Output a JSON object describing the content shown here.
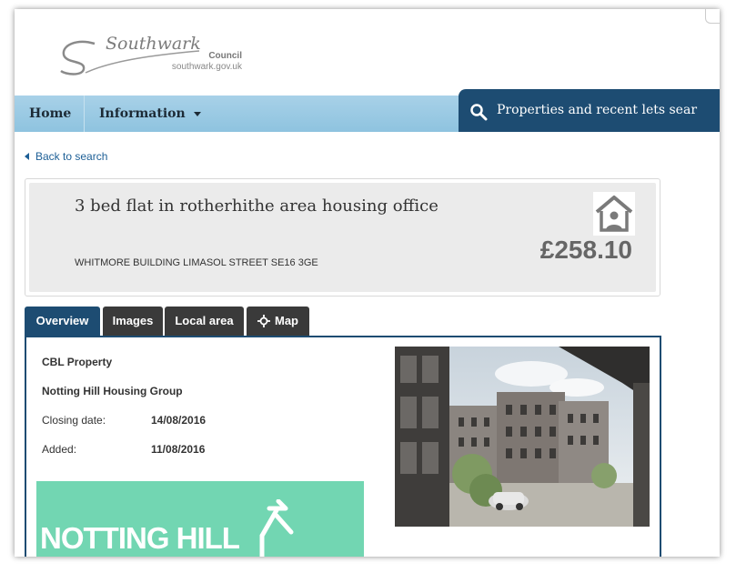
{
  "header": {
    "logo_name": "Southwark",
    "logo_council": "Council",
    "logo_url": "southwark.gov.uk"
  },
  "nav": {
    "home": "Home",
    "information": "Information",
    "search_tab": "Properties and recent lets sear"
  },
  "back_link": "Back to search",
  "property": {
    "title": "3 bed flat in rotherhithe area housing office",
    "address": "WHITMORE BUILDING LIMASOL STREET SE16 3GE",
    "price": "£258.10",
    "type_icon": "house-person-icon"
  },
  "tabs": [
    "Overview",
    "Images",
    "Local area",
    "Map"
  ],
  "overview": {
    "category": "CBL Property",
    "landlord": "Notting Hill Housing Group",
    "closing_label": "Closing date:",
    "closing_value": "14/08/2016",
    "added_label": "Added:",
    "added_value": "11/08/2016",
    "banner_text": "NOTTING HILL"
  },
  "colors": {
    "nav_bg": "#a8d1e8",
    "accent": "#1d4c72",
    "tab_dark": "#3a3a3a",
    "banner_green": "#72d6b2",
    "link": "#1d5f96"
  }
}
